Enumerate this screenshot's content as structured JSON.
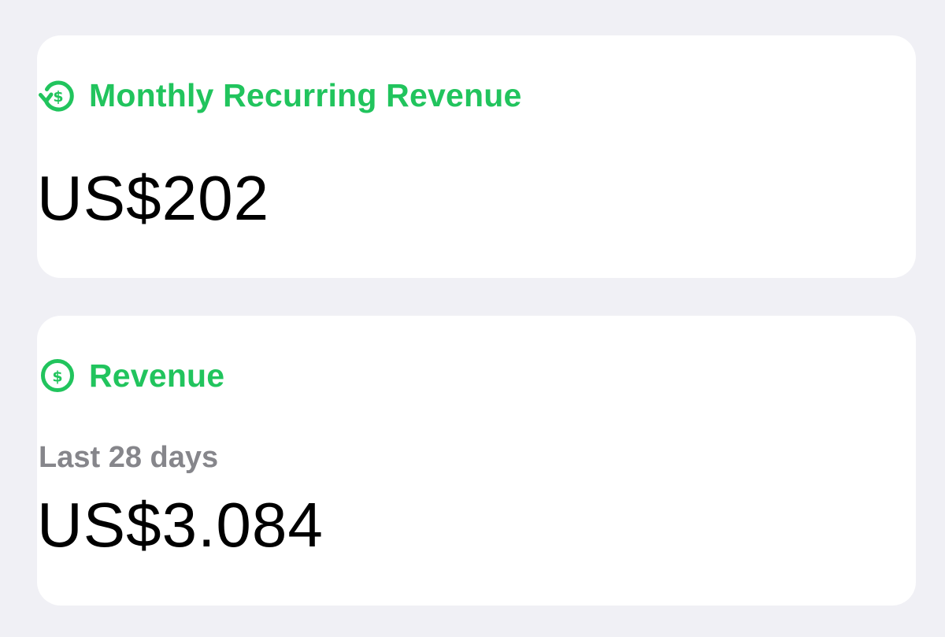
{
  "colors": {
    "background": "#f0f0f5",
    "card": "#ffffff",
    "accent": "#21c45d",
    "secondary_text": "#86868b",
    "primary_text": "#000000"
  },
  "cards": [
    {
      "title": "Monthly Recurring Revenue",
      "icon": "recurring-dollar-icon",
      "value": "US$202"
    },
    {
      "title": "Revenue",
      "icon": "dollar-circle-icon",
      "subtitle": "Last 28 days",
      "value": "US$3.084"
    }
  ]
}
